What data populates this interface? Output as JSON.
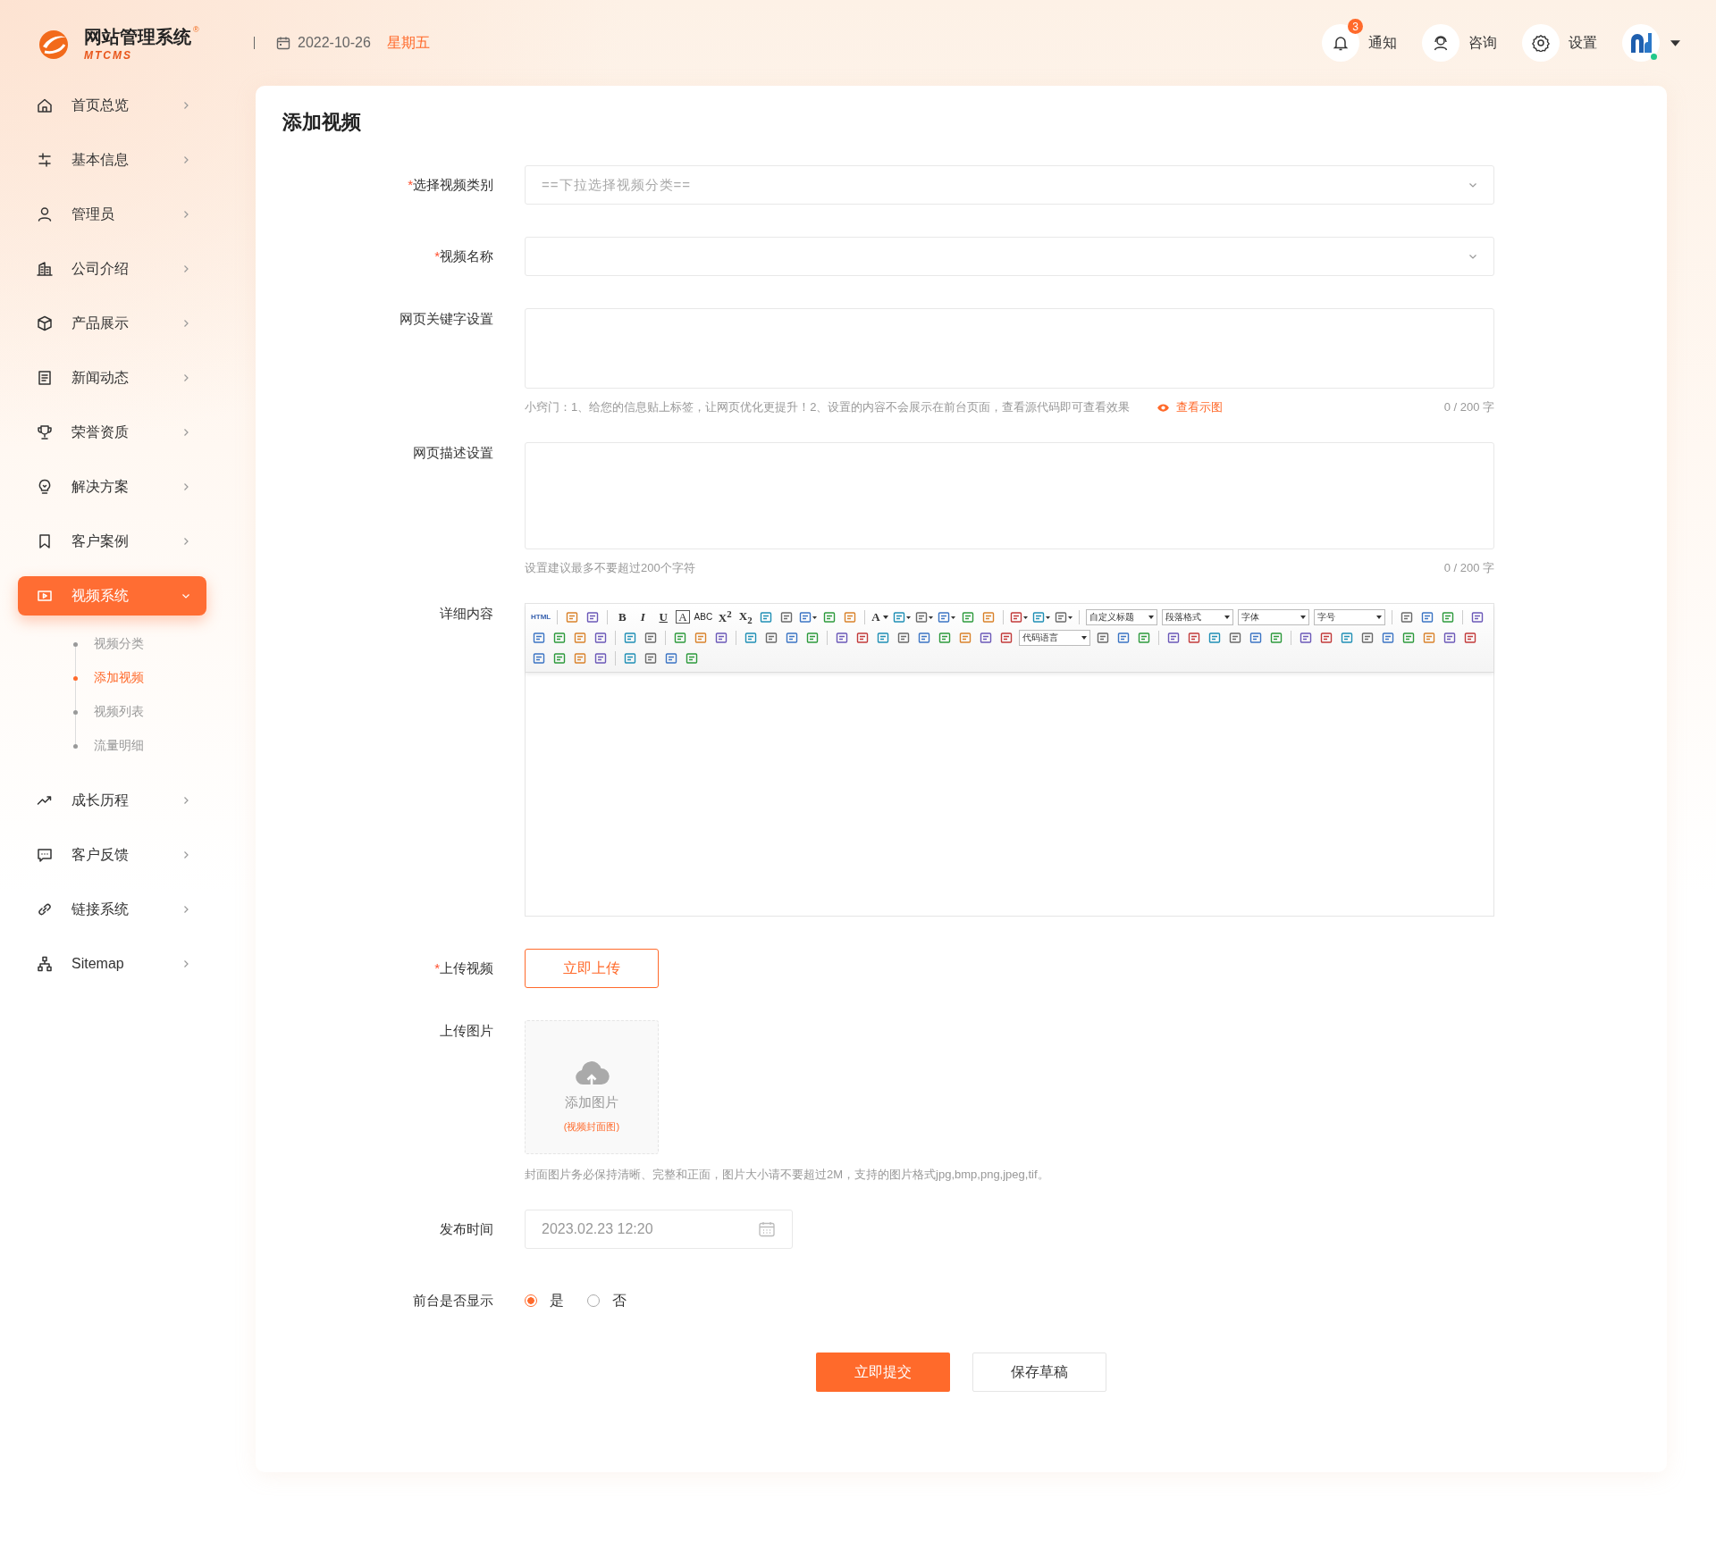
{
  "header": {
    "logo": {
      "title": "网站管理系统",
      "subtitle": "MTCMS",
      "mark": "®"
    },
    "date": "2022-10-26",
    "weekday": "星期五",
    "actions": [
      {
        "kind": "bell",
        "label": "通知",
        "badge": "3"
      },
      {
        "kind": "support",
        "label": "咨询"
      },
      {
        "kind": "gear",
        "label": "设置"
      }
    ],
    "user": {
      "online": true
    }
  },
  "sidebar": {
    "items": [
      {
        "label": "首页总览",
        "selected": false,
        "expanded": false
      },
      {
        "label": "基本信息",
        "selected": false,
        "expanded": false
      },
      {
        "label": "管理员",
        "selected": false,
        "expanded": false
      },
      {
        "label": "公司介绍",
        "selected": false,
        "expanded": false
      },
      {
        "label": "产品展示",
        "selected": false,
        "expanded": false
      },
      {
        "label": "新闻动态",
        "selected": false,
        "expanded": false
      },
      {
        "label": "荣誉资质",
        "selected": false,
        "expanded": false
      },
      {
        "label": "解决方案",
        "selected": false,
        "expanded": false
      },
      {
        "label": "客户案例",
        "selected": false,
        "expanded": false
      },
      {
        "label": "视频系统",
        "selected": true,
        "expanded": true,
        "children": [
          {
            "label": "视频分类",
            "selected": false
          },
          {
            "label": "添加视频",
            "selected": true
          },
          {
            "label": "视频列表",
            "selected": false
          },
          {
            "label": "流量明细",
            "selected": false
          }
        ]
      },
      {
        "label": "成长历程",
        "selected": false,
        "expanded": false
      },
      {
        "label": "客户反馈",
        "selected": false,
        "expanded": false
      },
      {
        "label": "链接系统",
        "selected": false,
        "expanded": false
      },
      {
        "label": "Sitemap",
        "selected": false,
        "expanded": false
      }
    ]
  },
  "page": {
    "title": "添加视频",
    "fields": [
      {
        "kind": "select",
        "label": "选择视频类别",
        "mark": "*",
        "placeholder": "==下拉选择视频分类=="
      },
      {
        "kind": "select",
        "label": "视频名称",
        "mark": "*"
      },
      {
        "kind": "textarea",
        "label": "网页关键字设置",
        "hint": "小窍门：1、给您的信息贴上标签，让网页优化更提升！2、设置的内容不会展示在前台页面，查看源代码即可查看效果",
        "link": "查看示图",
        "counter": "0 / 200 字"
      },
      {
        "kind": "textarea",
        "label": "网页描述设置",
        "hint": "设置建议最多不要超过200个字符",
        "counter": "0 / 200 字"
      },
      {
        "kind": "editor",
        "label": "详细内容",
        "toolbar": [
          [
            {
              "kind": "html",
              "text": "HTML"
            },
            {
              "kind": "sep"
            },
            {
              "kind": "icon"
            },
            {
              "kind": "icon"
            },
            {
              "kind": "sep"
            },
            {
              "kind": "bold",
              "text": "B"
            },
            {
              "kind": "italic",
              "text": "I"
            },
            {
              "kind": "underline",
              "text": "U"
            },
            {
              "kind": "boxed",
              "text": "A"
            },
            {
              "kind": "strike",
              "text": "ABC"
            },
            {
              "kind": "bold",
              "text": "X$^{2}$"
            },
            {
              "kind": "bold",
              "text": "X$_{2}$"
            },
            {
              "kind": "icon"
            },
            {
              "kind": "icon"
            },
            {
              "kind": "icon-menu"
            },
            {
              "kind": "icon"
            },
            {
              "kind": "icon"
            },
            {
              "kind": "sep"
            },
            {
              "kind": "bold-menu",
              "text": "A"
            },
            {
              "kind": "icon-menu"
            },
            {
              "kind": "icon-menu"
            },
            {
              "kind": "icon-menu"
            },
            {
              "kind": "icon"
            },
            {
              "kind": "icon"
            },
            {
              "kind": "sep"
            },
            {
              "kind": "icon-menu"
            },
            {
              "kind": "icon-menu"
            },
            {
              "kind": "icon-menu"
            },
            {
              "kind": "sep"
            },
            {
              "kind": "select",
              "text": "自定义标题"
            },
            {
              "kind": "select",
              "text": "段落格式"
            },
            {
              "kind": "select",
              "text": "字体"
            },
            {
              "kind": "select",
              "text": "字号"
            },
            {
              "kind": "sep"
            },
            {
              "kind": "icon"
            },
            {
              "kind": "icon"
            },
            {
              "kind": "icon"
            },
            {
              "kind": "sep"
            },
            {
              "kind": "icon"
            }
          ],
          [
            {
              "kind": "icon"
            },
            {
              "kind": "icon"
            },
            {
              "kind": "icon"
            },
            {
              "kind": "icon"
            },
            {
              "kind": "sep"
            },
            {
              "kind": "icon"
            },
            {
              "kind": "icon"
            },
            {
              "kind": "sep"
            },
            {
              "kind": "icon"
            },
            {
              "kind": "icon"
            },
            {
              "kind": "icon"
            },
            {
              "kind": "sep"
            },
            {
              "kind": "icon"
            },
            {
              "kind": "icon"
            },
            {
              "kind": "icon"
            },
            {
              "kind": "icon"
            },
            {
              "kind": "sep"
            },
            {
              "kind": "icon"
            },
            {
              "kind": "icon"
            },
            {
              "kind": "icon"
            },
            {
              "kind": "icon"
            },
            {
              "kind": "icon"
            },
            {
              "kind": "icon"
            },
            {
              "kind": "icon"
            },
            {
              "kind": "icon"
            },
            {
              "kind": "icon"
            },
            {
              "kind": "select",
              "text": "代码语言"
            },
            {
              "kind": "icon"
            },
            {
              "kind": "icon"
            },
            {
              "kind": "icon"
            },
            {
              "kind": "sep"
            },
            {
              "kind": "icon"
            },
            {
              "kind": "icon"
            },
            {
              "kind": "icon"
            },
            {
              "kind": "icon"
            },
            {
              "kind": "icon"
            },
            {
              "kind": "icon"
            },
            {
              "kind": "sep"
            },
            {
              "kind": "icon"
            },
            {
              "kind": "icon"
            },
            {
              "kind": "icon"
            },
            {
              "kind": "icon"
            },
            {
              "kind": "icon"
            },
            {
              "kind": "icon"
            },
            {
              "kind": "icon"
            },
            {
              "kind": "icon"
            },
            {
              "kind": "icon"
            }
          ],
          [
            {
              "kind": "icon"
            },
            {
              "kind": "icon"
            },
            {
              "kind": "icon"
            },
            {
              "kind": "icon"
            },
            {
              "kind": "sep"
            },
            {
              "kind": "icon"
            },
            {
              "kind": "icon"
            },
            {
              "kind": "icon"
            },
            {
              "kind": "icon"
            }
          ]
        ]
      },
      {
        "kind": "upload",
        "label": "上传视频",
        "mark": "*",
        "button": "立即上传"
      },
      {
        "kind": "image",
        "label": "上传图片",
        "text": "添加图片",
        "note": "(视频封面图)",
        "hint": "封面图片务必保持清晰、完整和正面，图片大小请不要超过2M，支持的图片格式jpg,bmp,png,jpeg,tif。"
      },
      {
        "kind": "date",
        "label": "发布时间",
        "value": "2023.02.23 12:20"
      },
      {
        "kind": "radio",
        "label": "前台是否显示",
        "options": [
          {
            "label": "是",
            "selected": true
          },
          {
            "label": "否",
            "selected": false
          }
        ]
      }
    ],
    "buttons": [
      {
        "kind": "primary",
        "label": "立即提交"
      },
      {
        "kind": "default",
        "label": "保存草稿"
      }
    ]
  }
}
